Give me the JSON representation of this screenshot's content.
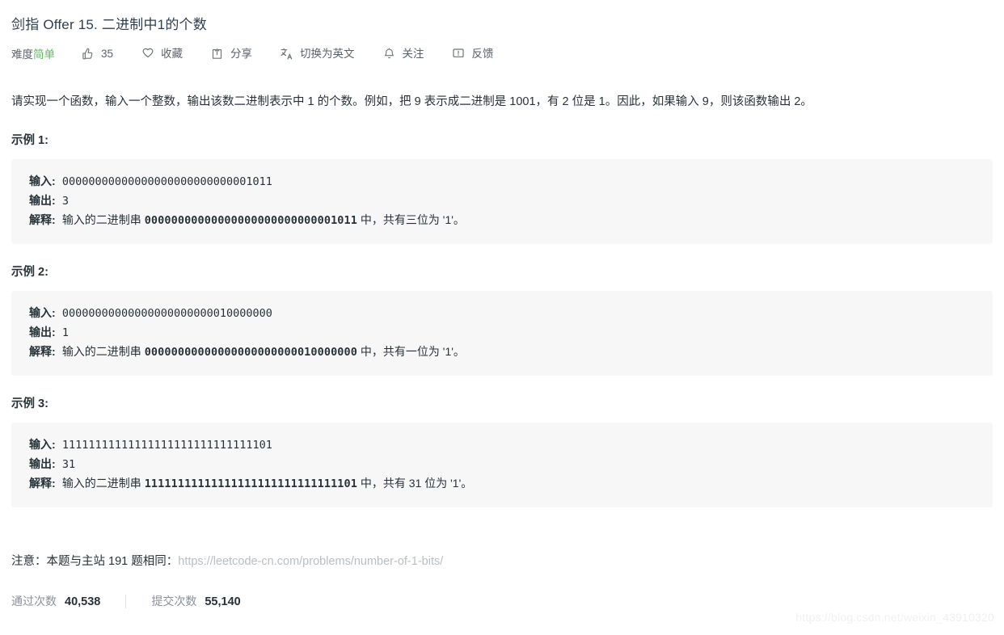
{
  "problem": {
    "title": "剑指 Offer 15. 二进制中1的个数",
    "description": "请实现一个函数，输入一个整数，输出该数二进制表示中 1 的个数。例如，把 9 表示成二进制是 1001，有 2 位是 1。因此，如果输入 9，则该函数输出 2。"
  },
  "meta": {
    "difficulty_label": "难度",
    "difficulty_value": "简单",
    "difficulty_color": "#5cb85c",
    "actions": [
      {
        "icon": "thumbs-up-icon",
        "label": "35",
        "name": "like-button"
      },
      {
        "icon": "heart-icon",
        "label": "收藏",
        "name": "favorite-button"
      },
      {
        "icon": "share-icon",
        "label": "分享",
        "name": "share-button"
      },
      {
        "icon": "translate-icon",
        "label": "切换为英文",
        "name": "translate-button"
      },
      {
        "icon": "bell-icon",
        "label": "关注",
        "name": "subscribe-button"
      },
      {
        "icon": "feedback-icon",
        "label": "反馈",
        "name": "feedback-button"
      }
    ]
  },
  "examples": [
    {
      "heading": "示例 1:",
      "input_label": "输入:",
      "input_value": "00000000000000000000000000001011",
      "output_label": "输出:",
      "output_value": "3",
      "explain_label": "解释:",
      "explain_prefix": "输入的二进制串 ",
      "explain_binary": "00000000000000000000000000001011",
      "explain_suffix": " 中，共有三位为 '1'。"
    },
    {
      "heading": "示例 2:",
      "input_label": "输入:",
      "input_value": "00000000000000000000000010000000",
      "output_label": "输出:",
      "output_value": "1",
      "explain_label": "解释:",
      "explain_prefix": "输入的二进制串 ",
      "explain_binary": "00000000000000000000000010000000",
      "explain_suffix": " 中，共有一位为 '1'。"
    },
    {
      "heading": "示例 3:",
      "input_label": "输入:",
      "input_value": "11111111111111111111111111111101",
      "output_label": "输出:",
      "output_value": "31",
      "explain_label": "解释:",
      "explain_prefix": "输入的二进制串 ",
      "explain_binary": "11111111111111111111111111111101",
      "explain_suffix": " 中，共有 31 位为 '1'。"
    }
  ],
  "note": {
    "text": "注意：本题与主站 191 题相同：",
    "link_text": "https://leetcode-cn.com/problems/number-of-1-bits/"
  },
  "stats": {
    "accepted_label": "通过次数",
    "accepted_value": "40,538",
    "submissions_label": "提交次数",
    "submissions_value": "55,140"
  },
  "watermark": "https://blog.csdn.net/weixin_43910320"
}
